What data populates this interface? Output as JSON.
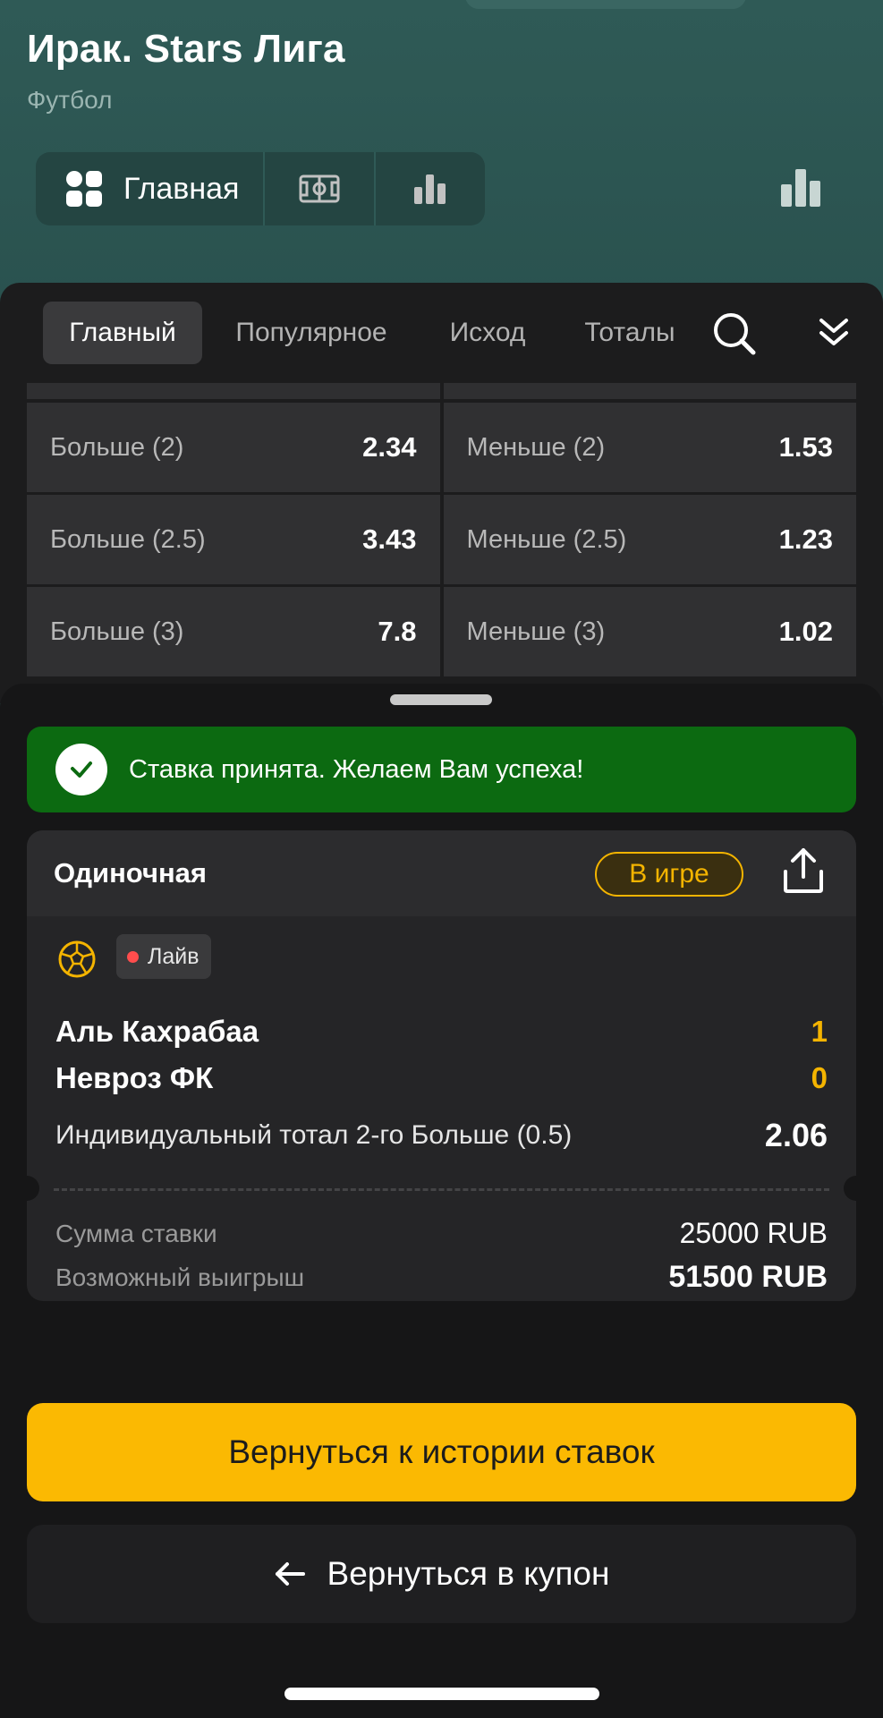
{
  "header": {
    "title": "Ирак. Stars Лига",
    "subtitle": "Футбол",
    "segments": {
      "main_label": "Главная",
      "icons": [
        "grid-icon",
        "field-icon",
        "stats-icon"
      ]
    },
    "right_icon": "stats-icon"
  },
  "market_tabs": {
    "items": [
      "Главный",
      "Популярное",
      "Исход",
      "Тоталы"
    ],
    "active_index": 0,
    "icons": [
      "search-icon",
      "collapse-icon"
    ]
  },
  "odds": [
    {
      "left": {
        "name": "Больше (2)",
        "value": "2.34"
      },
      "right": {
        "name": "Меньше (2)",
        "value": "1.53"
      }
    },
    {
      "left": {
        "name": "Больше (2.5)",
        "value": "3.43"
      },
      "right": {
        "name": "Меньше (2.5)",
        "value": "1.23"
      }
    },
    {
      "left": {
        "name": "Больше (3)",
        "value": "7.8"
      },
      "right": {
        "name": "Меньше (3)",
        "value": "1.02"
      }
    }
  ],
  "sheet": {
    "toast": "Ставка принята. Желаем Вам успеха!",
    "bet": {
      "type": "Одиночная",
      "status": "В игре",
      "live_label": "Лайв",
      "team1": {
        "name": "Аль Кахрабаа",
        "score": "1"
      },
      "team2": {
        "name": "Невроз ФК",
        "score": "0"
      },
      "market": "Индивидуальный тотал 2-го Больше (0.5)",
      "odd": "2.06",
      "stake_label": "Сумма ставки",
      "stake_value": "25000 RUB",
      "win_label": "Возможный выигрыш",
      "win_value": "51500 RUB"
    },
    "btn_history": "Вернуться к истории ставок",
    "btn_coupon": "Вернуться в купон"
  },
  "colors": {
    "header_bg": "#2c5451",
    "accent_yellow": "#fbb902",
    "success_green": "#0c6a11",
    "live_red": "#ff4d4d"
  }
}
